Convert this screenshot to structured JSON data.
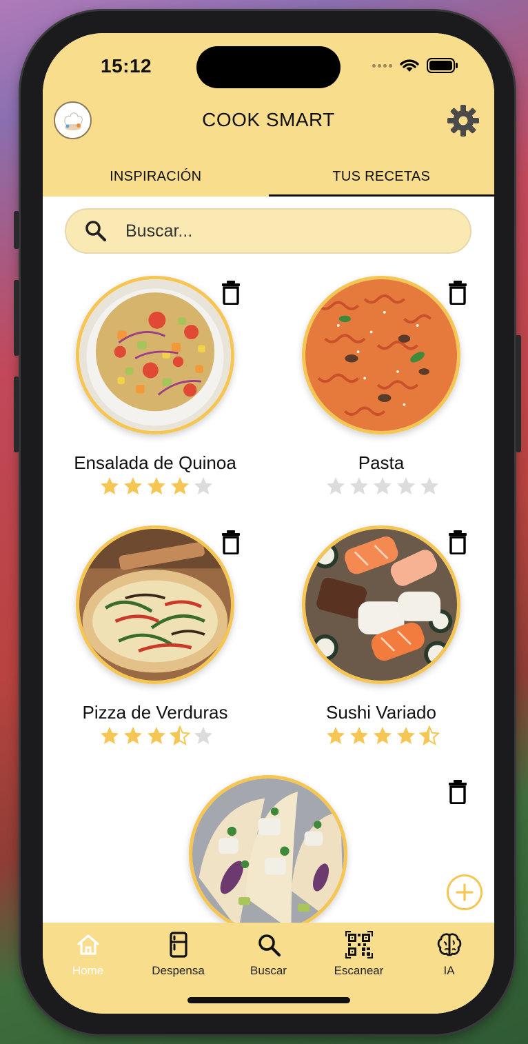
{
  "status": {
    "time": "15:12"
  },
  "header": {
    "title": "COOK SMART"
  },
  "tabs": [
    {
      "label": "INSPIRACIÓN",
      "active": false
    },
    {
      "label": "TUS RECETAS",
      "active": true
    }
  ],
  "search": {
    "placeholder": "Buscar..."
  },
  "recipes": [
    {
      "name": "Ensalada de Quinoa",
      "rating": 4,
      "max_rating": 5,
      "image": "quinoa-salad"
    },
    {
      "name": "Pasta",
      "rating": 0,
      "max_rating": 5,
      "image": "fusilli-pasta"
    },
    {
      "name": "Pizza de Verduras",
      "rating": 3.5,
      "max_rating": 5,
      "image": "vegetable-pizza"
    },
    {
      "name": "Sushi Variado",
      "rating": 4.5,
      "max_rating": 5,
      "image": "assorted-sushi"
    },
    {
      "name": "",
      "rating": null,
      "max_rating": 5,
      "image": "fish-tacos"
    }
  ],
  "bottom_nav": [
    {
      "label": "Home",
      "icon": "home-icon",
      "active": true
    },
    {
      "label": "Despensa",
      "icon": "fridge-icon",
      "active": false
    },
    {
      "label": "Buscar",
      "icon": "search-icon",
      "active": false
    },
    {
      "label": "Escanear",
      "icon": "qr-code-icon",
      "active": false
    },
    {
      "label": "IA",
      "icon": "brain-icon",
      "active": false
    }
  ],
  "colors": {
    "header_bg": "#f8dd8c",
    "accent": "#f5c653",
    "star_filled": "#f5c653",
    "star_empty": "#dcdcdc",
    "search_bg": "#fbe9b4"
  }
}
